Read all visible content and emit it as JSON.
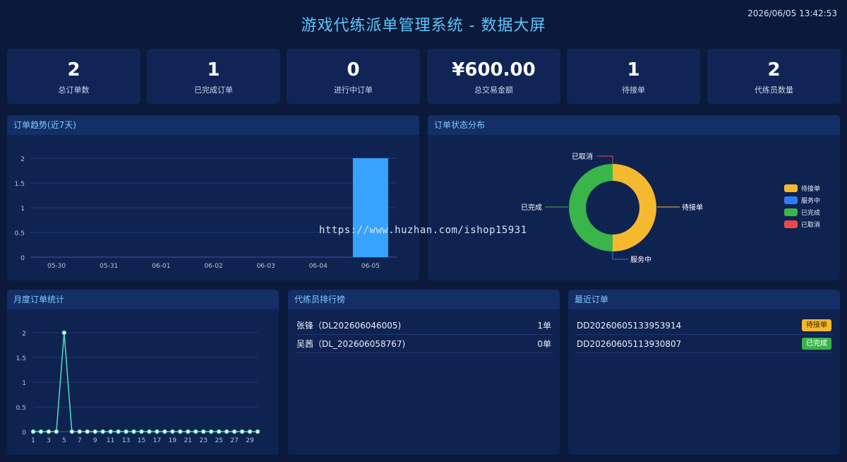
{
  "header": {
    "title": "游戏代练派单管理系统 - 数据大屏",
    "datetime": "2026/06/05 13:42:53"
  },
  "stats": [
    {
      "value": "2",
      "label": "总订单数"
    },
    {
      "value": "1",
      "label": "已完成订单"
    },
    {
      "value": "0",
      "label": "进行中订单"
    },
    {
      "value": "¥600.00",
      "label": "总交易金额"
    },
    {
      "value": "1",
      "label": "待接单"
    },
    {
      "value": "2",
      "label": "代练员数量"
    }
  ],
  "panels": {
    "trend_title": "订单趋势(近7天)",
    "status_title": "订单状态分布",
    "monthly_title": "月度订单统计",
    "ranking_title": "代练员排行榜",
    "recent_title": "最近订单"
  },
  "ranking": [
    {
      "name": "张锋（DL202606046005)",
      "count": "1单"
    },
    {
      "name": "吴茜（DL_202606058767)",
      "count": "0单"
    }
  ],
  "recent_orders": [
    {
      "id": "DD20260605133953914",
      "status": "待接单",
      "color": "#f5b92f"
    },
    {
      "id": "DD20260605113930807",
      "status": "已完成",
      "color": "#39b54a"
    }
  ],
  "watermark": "https://www.huzhan.com/ishop15931",
  "chart_data": [
    {
      "type": "bar",
      "title": "订单趋势(近7天)",
      "categories": [
        "05-30",
        "05-31",
        "06-01",
        "06-02",
        "06-03",
        "06-04",
        "06-05"
      ],
      "values": [
        0,
        0,
        0,
        0,
        0,
        0,
        2
      ],
      "ylim": [
        0,
        2
      ],
      "yticks": [
        "0",
        "0.5",
        "1",
        "1.5",
        "2"
      ],
      "color": "#37a3ff",
      "grid": true
    },
    {
      "type": "pie",
      "title": "订单状态分布",
      "donut": true,
      "slices": [
        {
          "name": "待接单",
          "value": 1,
          "color": "#f5b92f"
        },
        {
          "name": "服务中",
          "value": 0,
          "color": "#2f7cf6"
        },
        {
          "name": "已完成",
          "value": 1,
          "color": "#39b54a"
        },
        {
          "name": "已取消",
          "value": 0,
          "color": "#e84a4a"
        }
      ],
      "legend": "right"
    },
    {
      "type": "line",
      "title": "月度订单统计",
      "x": [
        1,
        2,
        3,
        4,
        5,
        6,
        7,
        8,
        9,
        10,
        11,
        12,
        13,
        14,
        15,
        16,
        17,
        18,
        19,
        20,
        21,
        22,
        23,
        24,
        25,
        26,
        27,
        28,
        29,
        30
      ],
      "values": [
        0,
        0,
        0,
        0,
        2,
        0,
        0,
        0,
        0,
        0,
        0,
        0,
        0,
        0,
        0,
        0,
        0,
        0,
        0,
        0,
        0,
        0,
        0,
        0,
        0,
        0,
        0,
        0,
        0,
        0
      ],
      "xtick_labels": [
        "1",
        "3",
        "5",
        "7",
        "9",
        "11",
        "13",
        "15",
        "17",
        "19",
        "21",
        "23",
        "25",
        "27",
        "29"
      ],
      "ylim": [
        0,
        2
      ],
      "yticks": [
        "0",
        "0.5",
        "1",
        "1.5",
        "2"
      ],
      "color": "#4fe0c4",
      "grid": true
    }
  ]
}
